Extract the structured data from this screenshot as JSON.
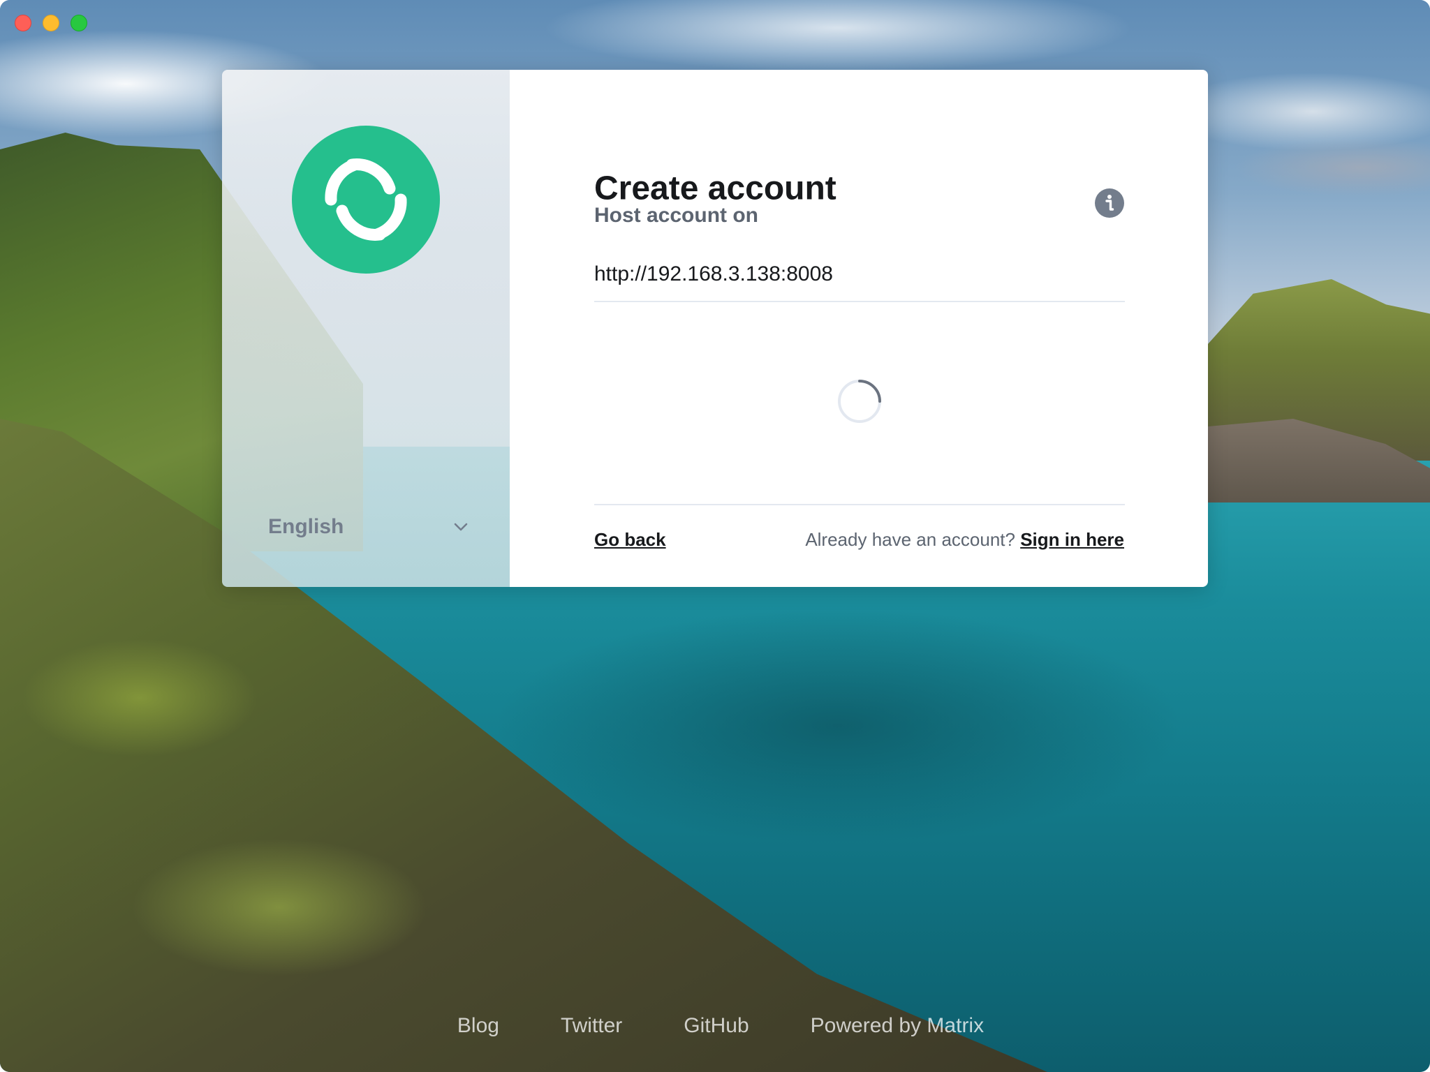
{
  "window": {
    "controls": [
      "close",
      "minimize",
      "maximize"
    ]
  },
  "auth": {
    "title": "Create account",
    "host_label": "Host account on",
    "server_url": "http://192.168.3.138:8008",
    "go_back": "Go back",
    "already_text": "Already have an account?",
    "sign_in_link": "Sign in here",
    "language": "English",
    "logo_color": "#25bf8d",
    "info_icon": "info-icon",
    "spinner_icon": "loading-spinner-icon"
  },
  "footer": {
    "links": [
      "Blog",
      "Twitter",
      "GitHub",
      "Powered by Matrix"
    ]
  }
}
